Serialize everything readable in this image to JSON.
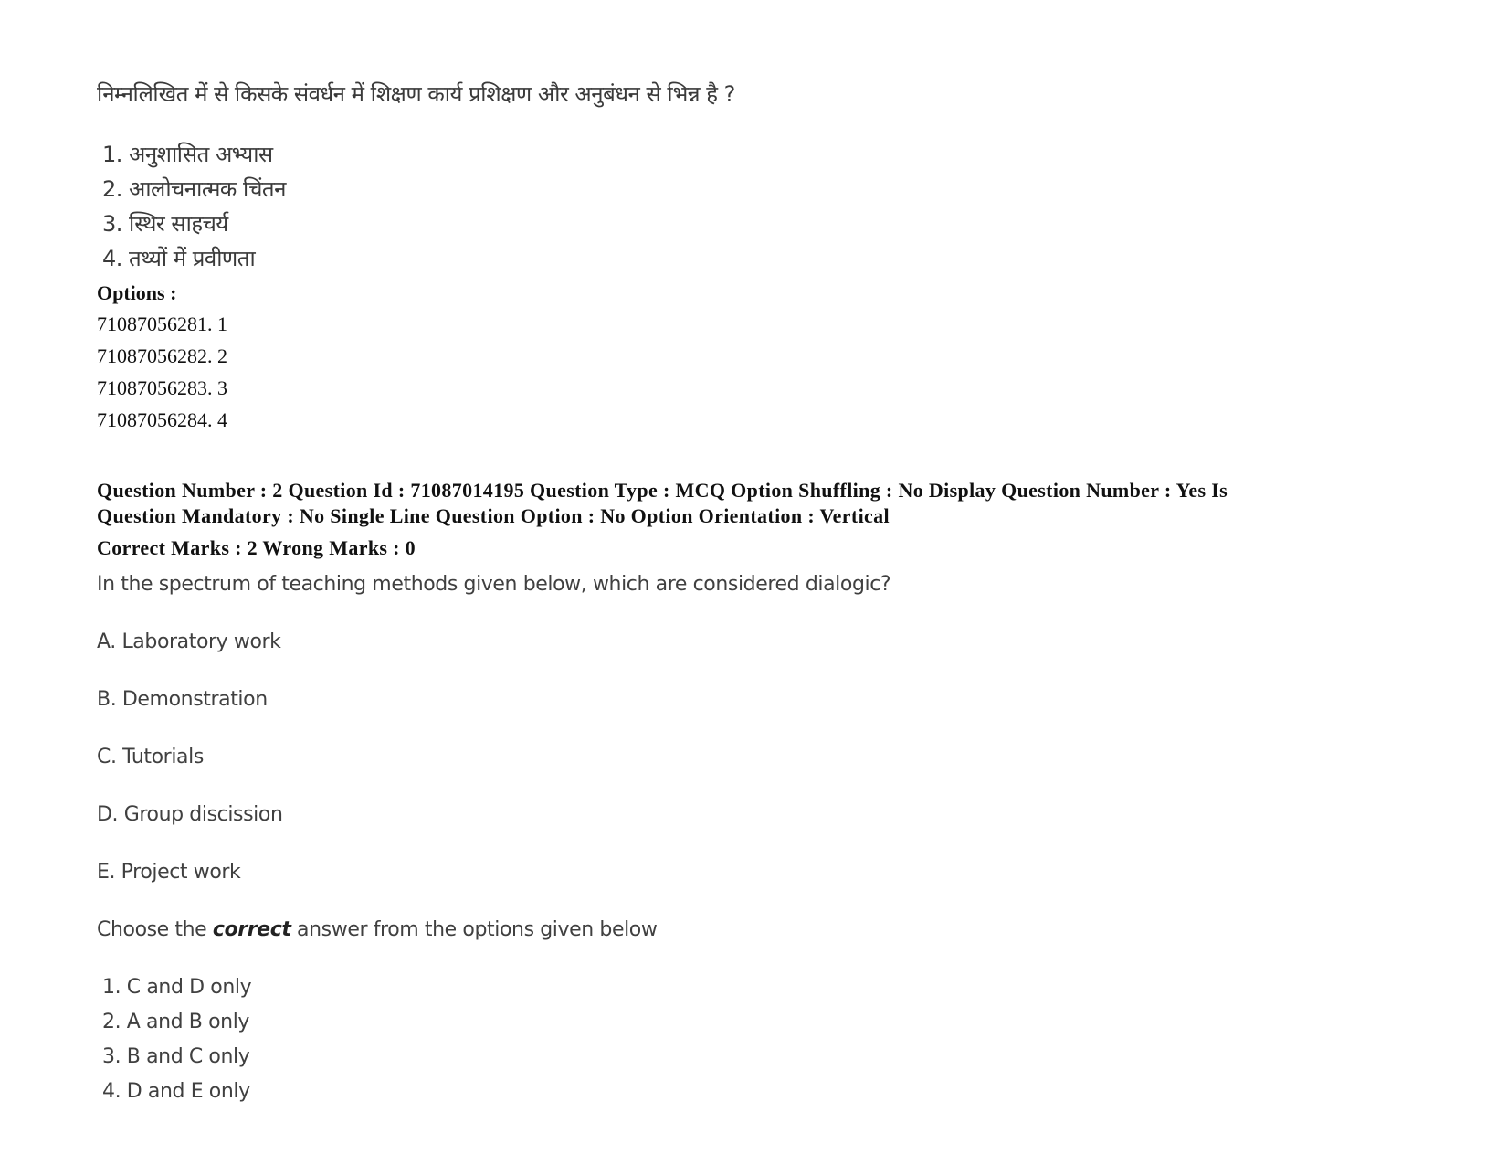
{
  "previous_question": {
    "question_text": "निम्नलिखित में से किसके संवर्धन में शिक्षण कार्य प्रशिक्षण और अनुबंधन से भिन्न है ?",
    "statements": [
      "1. अनुशासित अभ्यास",
      "2. आलोचनात्मक चिंतन",
      "3. स्थिर साहचर्य",
      "4. तथ्यों में प्रवीणता"
    ],
    "options_label": "Options :",
    "options": [
      "71087056281. 1",
      "71087056282. 2",
      "71087056283. 3",
      "71087056284. 4"
    ]
  },
  "question": {
    "meta_line_1": "Question Number : 2 Question Id : 71087014195 Question Type : MCQ Option Shuffling : No Display Question Number : Yes Is",
    "meta_line_2": "Question Mandatory : No Single Line Question Option : No Option Orientation : Vertical",
    "marks_line": "Correct Marks : 2 Wrong Marks : 0",
    "question_number": "2",
    "question_id": "71087014195",
    "question_type": "MCQ",
    "correct_marks": "2",
    "wrong_marks": "0",
    "question_text": "In the spectrum of teaching methods given below, which are considered dialogic?",
    "statements": [
      "A. Laboratory work",
      "B. Demonstration",
      "C. Tutorials",
      "D. Group discission",
      "E. Project work"
    ],
    "instruction_prefix": "Choose the ",
    "instruction_emphasis": "correct",
    "instruction_suffix": " answer from the options given below",
    "answer_choices": [
      "1. C and D only",
      "2. A and B only",
      "3. B and C only",
      "4. D and E only"
    ]
  }
}
